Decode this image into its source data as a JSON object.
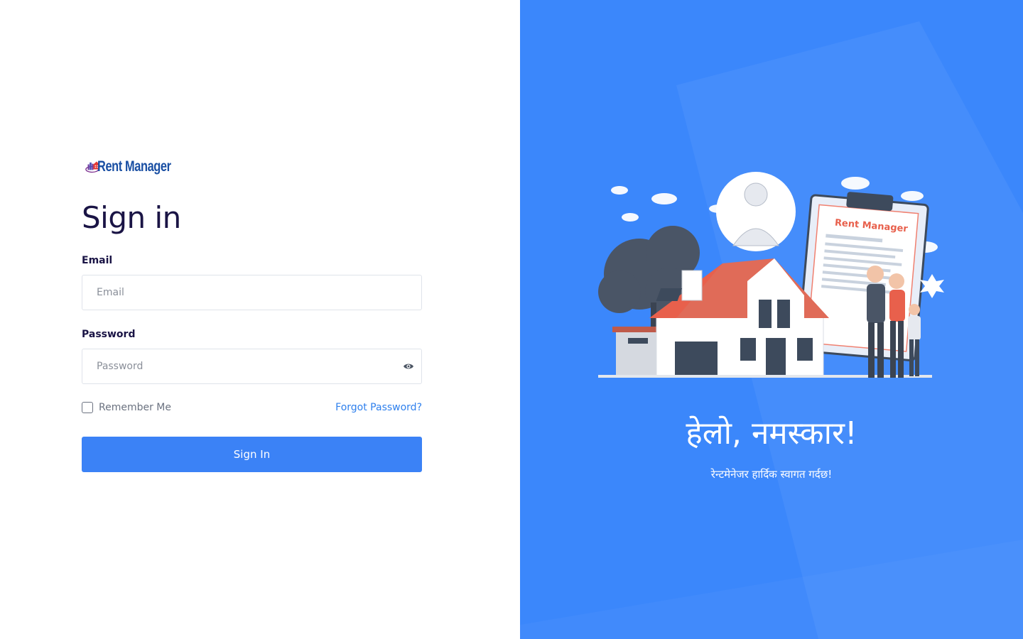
{
  "brand": {
    "name": "Rent Manager",
    "illustration_label": "Rent Manager"
  },
  "form": {
    "title": "Sign in",
    "email": {
      "label": "Email",
      "placeholder": "Email",
      "value": ""
    },
    "password": {
      "label": "Password",
      "placeholder": "Password",
      "value": ""
    },
    "remember_label": "Remember Me",
    "remember_checked": false,
    "forgot_label": "Forgot Password?",
    "submit_label": "Sign In"
  },
  "hero": {
    "greeting": "हेलो, नमस्कार!",
    "subtitle": "रेन्टमेनेजर हार्दिक स्वागत गर्दछ!"
  },
  "colors": {
    "primary": "#3b82f6",
    "hero_bg": "#3b87fb",
    "heading": "#1a1445",
    "link": "#2f80ed"
  }
}
